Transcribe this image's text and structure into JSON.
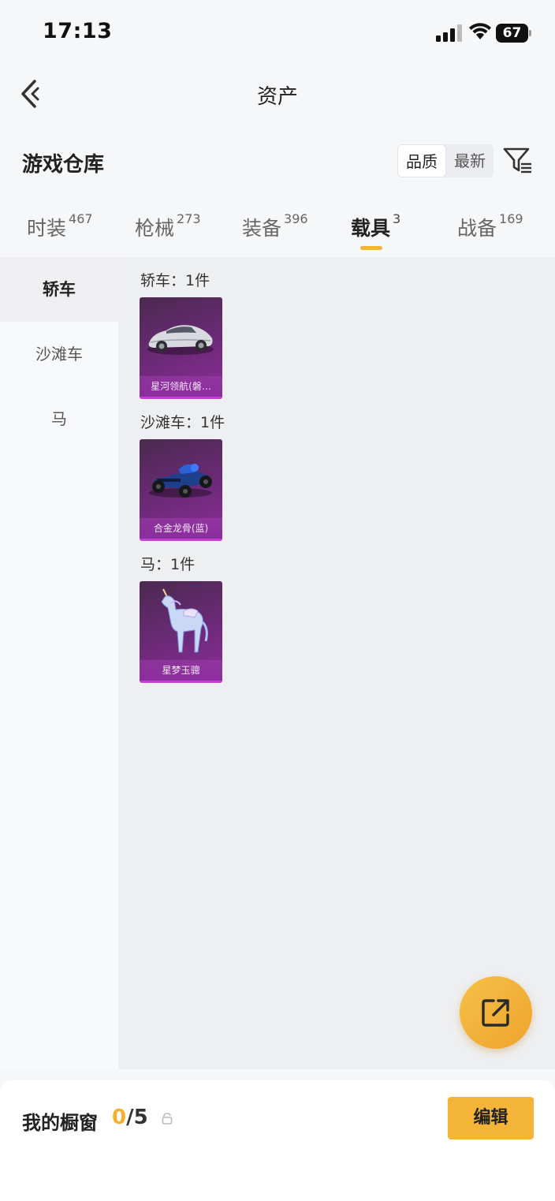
{
  "status_bar": {
    "time": "17:13",
    "battery": "67"
  },
  "nav": {
    "title": "资产"
  },
  "section": {
    "title": "游戏仓库"
  },
  "sort": {
    "options": [
      "品质",
      "最新"
    ],
    "active": "品质"
  },
  "tabs": [
    {
      "label": "时装",
      "count": "467"
    },
    {
      "label": "枪械",
      "count": "273"
    },
    {
      "label": "装备",
      "count": "396"
    },
    {
      "label": "载具",
      "count": "3"
    },
    {
      "label": "战备",
      "count": "169"
    }
  ],
  "active_tab": "载具",
  "sidebar": {
    "items": [
      {
        "label": "轿车"
      },
      {
        "label": "沙滩车"
      },
      {
        "label": "马"
      }
    ],
    "active": "轿车"
  },
  "groups": [
    {
      "label": "轿车：1件",
      "items": [
        {
          "name": "星河领航(磐…"
        }
      ]
    },
    {
      "label": "沙滩车：1件",
      "items": [
        {
          "name": "合金龙骨(蓝)"
        }
      ]
    },
    {
      "label": "马：1件",
      "items": [
        {
          "name": "星梦玉骢"
        }
      ]
    }
  ],
  "bottom": {
    "showcase_label": "我的橱窗",
    "showcase_current": "0",
    "showcase_total": "/5",
    "edit_label": "编辑"
  },
  "colors": {
    "accent": "#f3b437",
    "card_purple": "#7b2c88"
  }
}
